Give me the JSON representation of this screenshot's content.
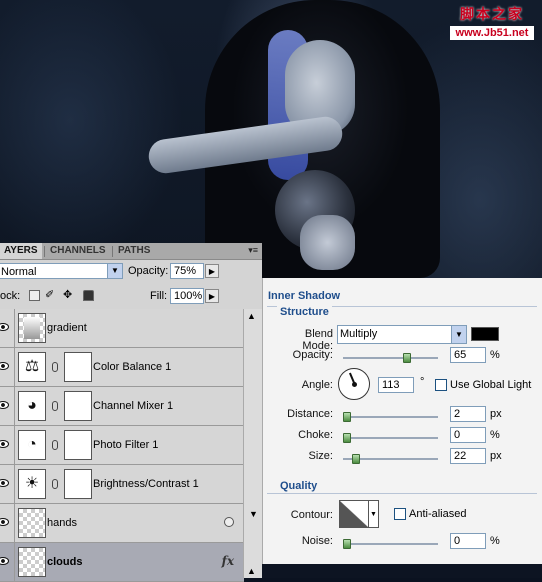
{
  "watermark": {
    "line1": "脚本之家",
    "line2": "www.Jb51.net"
  },
  "layers_panel": {
    "tabs": [
      "AYERS",
      "CHANNELS",
      "PATHS"
    ],
    "menu_glyph": "▾≡",
    "blend_mode": "Normal",
    "opacity_label": "Opacity:",
    "opacity_value": "75%",
    "lock_label": "ock:",
    "fill_label": "Fill:",
    "fill_value": "100%",
    "layers": [
      {
        "name": "gradient",
        "kind": "gradient"
      },
      {
        "name": "Color Balance 1",
        "kind": "adjust",
        "glyph": "⚖"
      },
      {
        "name": "Channel Mixer 1",
        "kind": "adjust",
        "glyph": "◕"
      },
      {
        "name": "Photo Filter 1",
        "kind": "adjust",
        "glyph": "◔"
      },
      {
        "name": "Brightness/Contrast 1",
        "kind": "adjust",
        "glyph": "☀"
      },
      {
        "name": "hands",
        "kind": "pixel"
      },
      {
        "name": "clouds",
        "kind": "pixel",
        "fx": "fx",
        "selected": true
      }
    ]
  },
  "layer_style": {
    "title": "Inner Shadow",
    "structure": {
      "heading": "Structure",
      "blend_mode_label": "Blend Mode:",
      "blend_mode": "Multiply",
      "shadow_color": "#000000",
      "opacity_label": "Opacity:",
      "opacity": "65",
      "angle_label": "Angle:",
      "angle": "113",
      "angle_unit": "°",
      "use_global_light": "Use Global Light",
      "distance_label": "Distance:",
      "distance": "2",
      "choke_label": "Choke:",
      "choke": "0",
      "size_label": "Size:",
      "size": "22",
      "unit_px": "px",
      "unit_pct": "%"
    },
    "quality": {
      "heading": "Quality",
      "contour_label": "Contour:",
      "anti_aliased": "Anti-aliased",
      "noise_label": "Noise:",
      "noise": "0",
      "unit_pct": "%"
    }
  }
}
